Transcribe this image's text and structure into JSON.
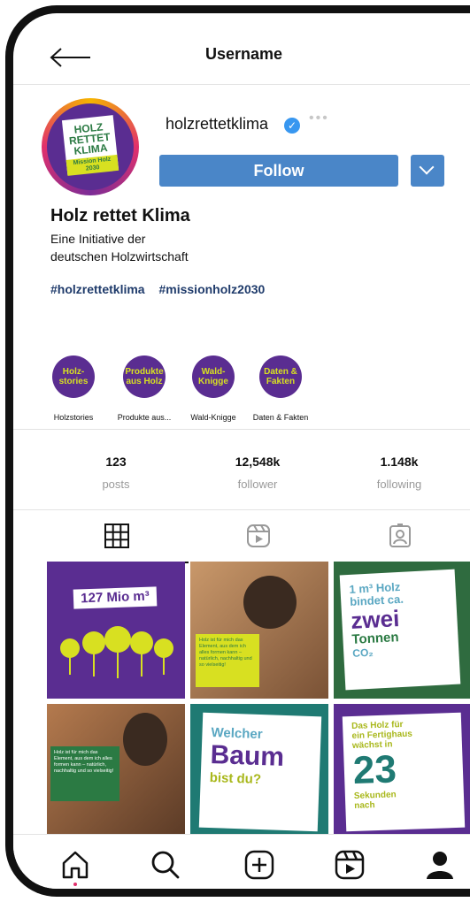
{
  "header": {
    "title": "Username"
  },
  "profile": {
    "handle": "holzrettetklima",
    "avatar_text": [
      "HOLZ",
      "RETTET",
      "KLIMA"
    ],
    "avatar_tag": "Mission Holz 2030",
    "follow_label": "Follow",
    "name": "Holz rettet Klima",
    "bio": [
      "Eine Initiative der",
      "deutschen Holzwirtschaft"
    ],
    "hashtags": [
      "#holzrettetklima",
      "#missionholz2030"
    ]
  },
  "highlights": [
    {
      "circle": "Holz-\nstories",
      "label": "Holzstories"
    },
    {
      "circle": "Produkte\naus Holz",
      "label": "Produkte aus..."
    },
    {
      "circle": "Wald-\nKnigge",
      "label": "Wald-Knigge"
    },
    {
      "circle": "Daten &\nFakten",
      "label": "Daten & Fakten"
    }
  ],
  "stats": {
    "posts": {
      "value": "123",
      "label": "posts"
    },
    "follower": {
      "value": "12,548k",
      "label": "follower"
    },
    "following": {
      "value": "1.148k",
      "label": "following"
    }
  },
  "posts": [
    {
      "headline": "127 Mio m³"
    },
    {
      "text": "Holz ist für mich das Element, aus dem ich alles formen kann – natürlich, nachhaltig und so vielseitig!"
    },
    {
      "lines": [
        "1 m³ Holz",
        "bindet ca.",
        "zwei",
        "Tonnen",
        "CO₂"
      ]
    },
    {
      "text": "Holz ist für mich das Element, aus dem ich alles formen kann – natürlich, nachhaltig und so vielseitig!"
    },
    {
      "lines": [
        "Welcher",
        "Baum",
        "bist du?"
      ]
    },
    {
      "lines": [
        "Das Holz für",
        "ein Fertighaus",
        "wächst in",
        "23",
        "Sekunden",
        "nach"
      ]
    }
  ],
  "colors": {
    "brand_purple": "#5a2d91",
    "brand_lime": "#d8e021",
    "brand_green": "#2b7a43",
    "follow_blue": "#4a86c8"
  },
  "icons": [
    "back-arrow-icon",
    "verified-icon",
    "more-icon",
    "grid-icon",
    "reels-icon",
    "tagged-icon",
    "home-icon",
    "search-icon",
    "add-icon",
    "reels-nav-icon",
    "profile-icon"
  ]
}
